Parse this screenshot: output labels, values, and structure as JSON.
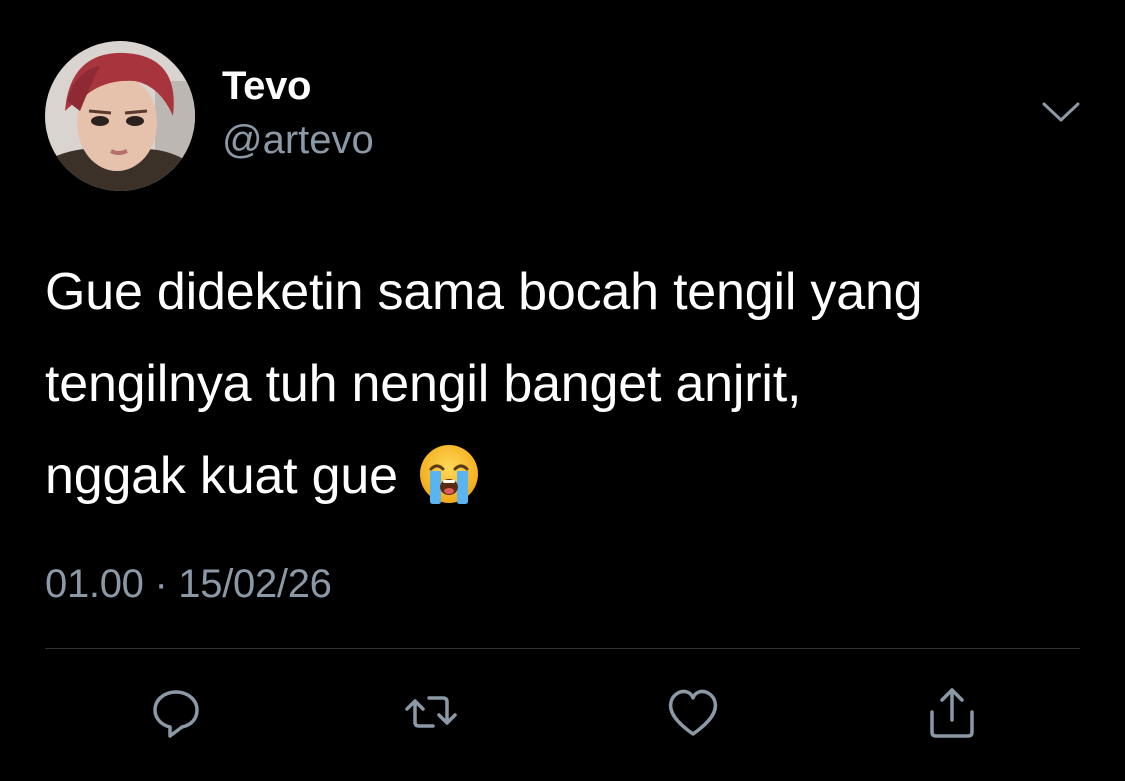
{
  "author": {
    "display_name": "Tevo",
    "handle": "@artevo",
    "avatar_icon": "profile-photo"
  },
  "tweet": {
    "lines": [
      "Gue dideketin sama bocah tengil yang",
      "tengilnya tuh nengil banget anjrit,",
      "nggak kuat gue"
    ],
    "emoji": "loudly-crying-face",
    "time": "01.00",
    "separator": "·",
    "date": "15/02/26"
  },
  "actions": [
    {
      "name": "reply",
      "icon": "reply-icon"
    },
    {
      "name": "retweet",
      "icon": "retweet-icon"
    },
    {
      "name": "like",
      "icon": "heart-icon"
    },
    {
      "name": "share",
      "icon": "share-icon"
    }
  ],
  "colors": {
    "background": "#000000",
    "primary_text": "#ffffff",
    "secondary_text": "#8b98a5",
    "divider": "#2f3336"
  }
}
